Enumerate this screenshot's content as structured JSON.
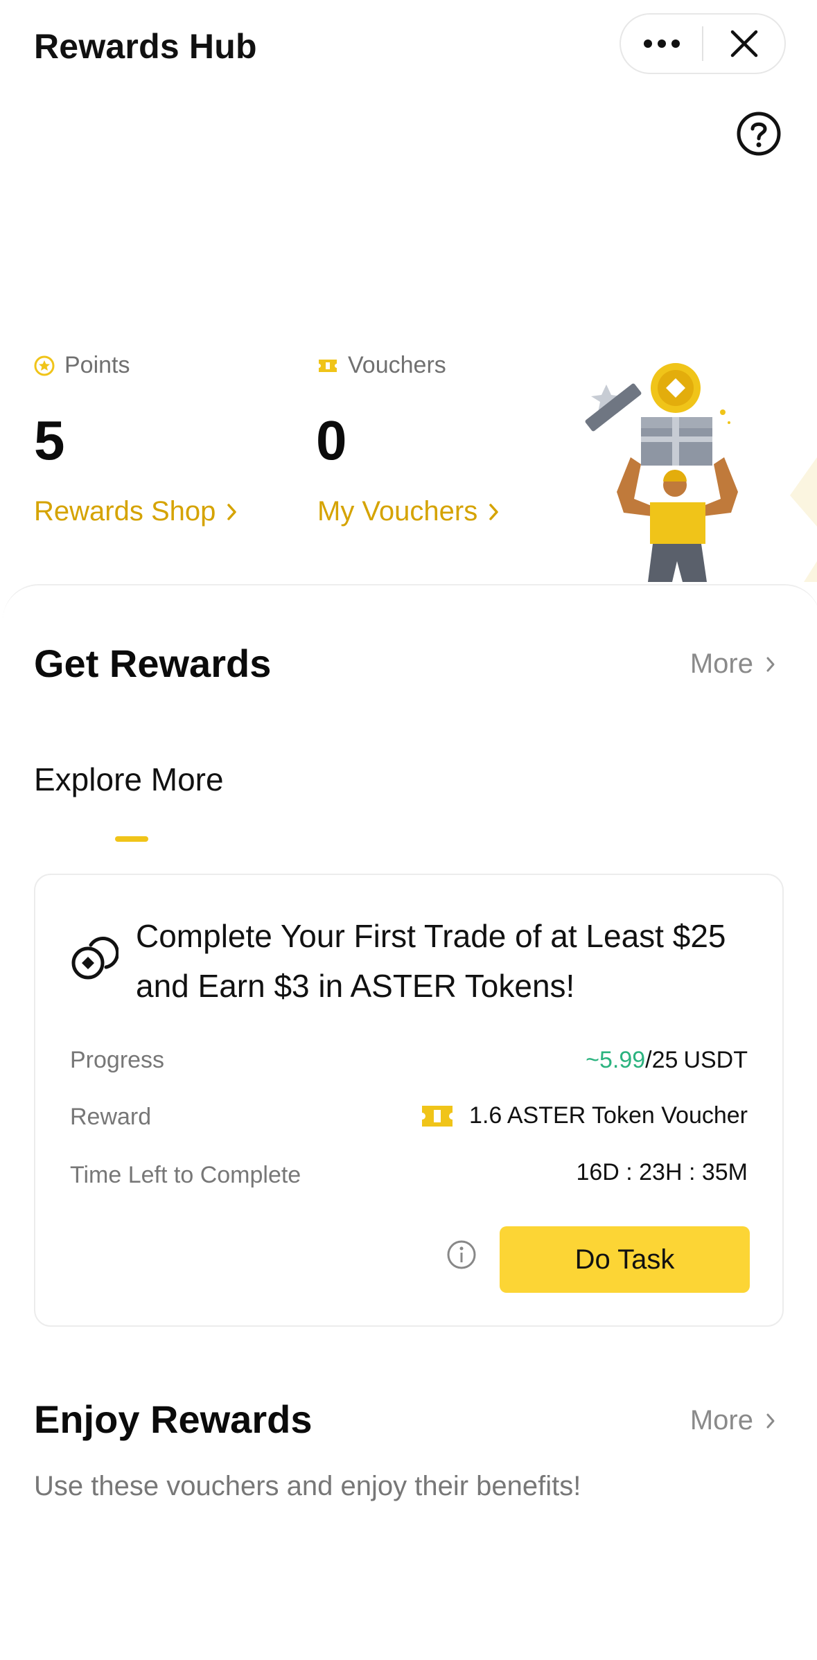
{
  "header": {
    "title": "Rewards Hub",
    "menu_icon": "more-dots-icon",
    "close_icon": "close-icon",
    "help_icon": "help-circle-icon"
  },
  "stats": {
    "points": {
      "label": "Points",
      "value": "5",
      "link": "Rewards Shop",
      "icon": "star-coin-icon"
    },
    "vouchers": {
      "label": "Vouchers",
      "value": "0",
      "link": "My Vouchers",
      "icon": "ticket-icon"
    }
  },
  "get_rewards": {
    "title": "Get Rewards",
    "more": "More",
    "tab": "Explore More",
    "task": {
      "title": "Complete Your First Trade of at Least $25 and Earn $3 in ASTER Tokens!",
      "progress_label": "Progress",
      "progress_current": "~5.99",
      "progress_total": "/25",
      "progress_unit": "USDT",
      "reward_label": "Reward",
      "reward_value": "1.6 ASTER Token Voucher",
      "time_label": "Time Left to Complete",
      "time_value": "16D : 23H : 35M",
      "button": "Do Task"
    }
  },
  "enjoy_rewards": {
    "title": "Enjoy Rewards",
    "more": "More",
    "subtitle": "Use these vouchers and enjoy their benefits!"
  },
  "colors": {
    "accent_yellow": "#FCD535",
    "link_gold": "#D5A300",
    "progress_green": "#2BB37F"
  }
}
